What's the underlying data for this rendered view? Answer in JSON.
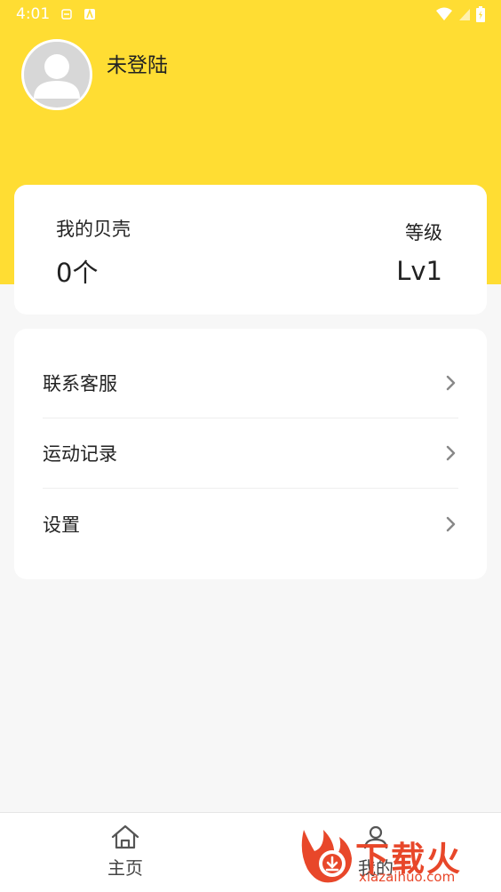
{
  "status_bar": {
    "time": "4:01"
  },
  "profile": {
    "username": "未登陆"
  },
  "stats": {
    "shells_label": "我的贝壳",
    "shells_value": "0个",
    "level_label": "等级",
    "level_value": "Lv1"
  },
  "menu": {
    "items": [
      {
        "label": "联系客服"
      },
      {
        "label": "运动记录"
      },
      {
        "label": "设置"
      }
    ]
  },
  "tabbar": {
    "home_label": "主页",
    "me_label": "我的"
  },
  "watermark": {
    "brand": "下载火",
    "domain": "xiazaihuo.com"
  },
  "colors": {
    "header": "#ffdd33",
    "background": "#f7f7f7",
    "card": "#ffffff",
    "watermark": "#e8472a"
  }
}
